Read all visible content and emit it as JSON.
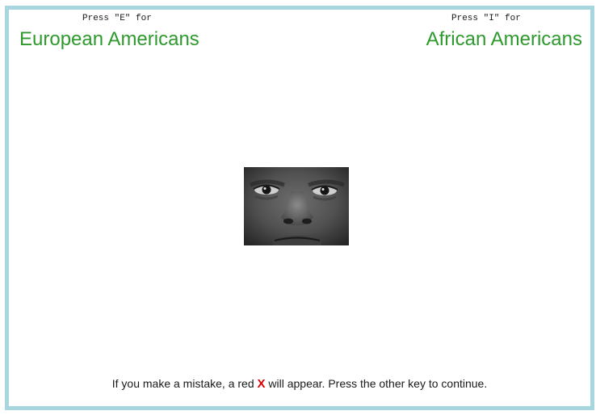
{
  "left_category": {
    "press_hint": "Press \"E\" for",
    "label": "European Americans"
  },
  "right_category": {
    "press_hint": "Press \"I\" for",
    "label": "African Americans"
  },
  "stimulus": {
    "description_icon": "face-photo"
  },
  "instruction": {
    "before": "If you make a mistake, a red ",
    "mark": "X",
    "after": " will appear. Press the other key to continue."
  },
  "colors": {
    "border": "#a8d6de",
    "category_text": "#2e9a2e",
    "error_mark": "#e00000"
  }
}
